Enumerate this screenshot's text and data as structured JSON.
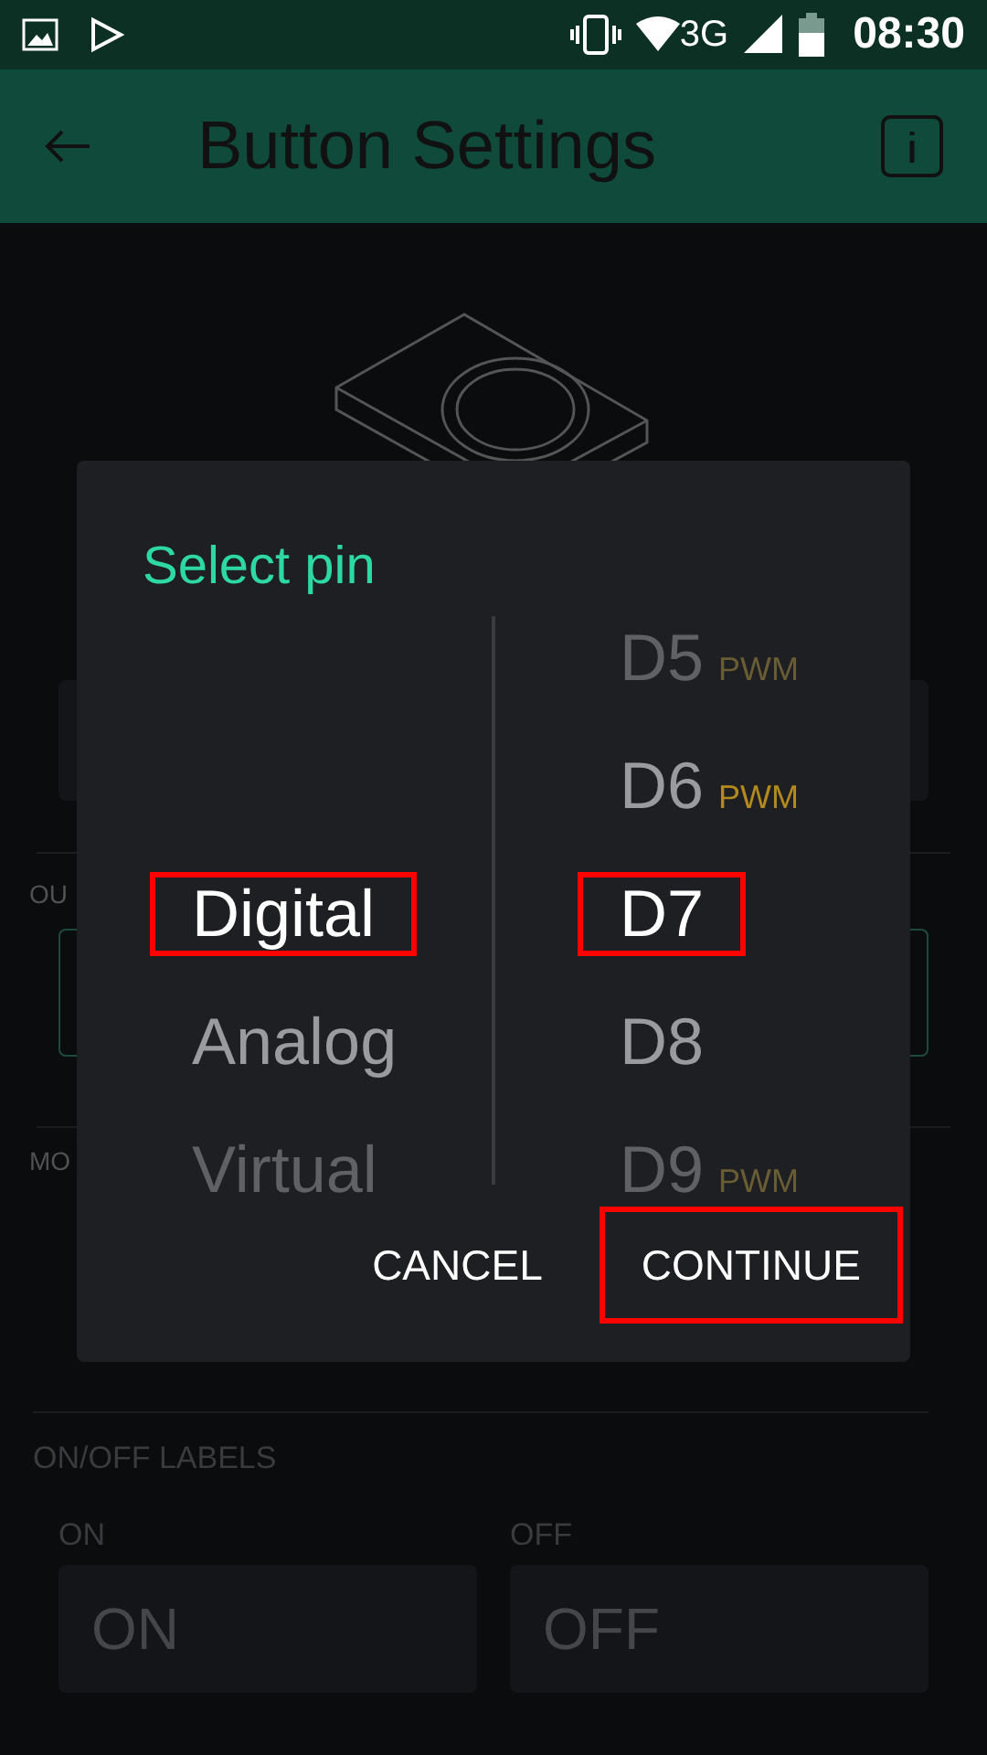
{
  "status_bar": {
    "time": "08:30",
    "network": "3G"
  },
  "app_bar": {
    "title": "Button Settings"
  },
  "background": {
    "section_labels": [
      "OU",
      "MO"
    ],
    "labels_section": {
      "title": "ON/OFF LABELS",
      "fields": [
        {
          "label": "ON",
          "placeholder": "ON"
        },
        {
          "label": "OFF",
          "placeholder": "OFF"
        }
      ]
    }
  },
  "dialog": {
    "title": "Select pin",
    "pin_types": [
      {
        "label": "Digital",
        "selected": true,
        "highlighted": true
      },
      {
        "label": "Analog",
        "selected": false,
        "highlighted": false
      },
      {
        "label": "Virtual",
        "selected": false,
        "highlighted": false
      }
    ],
    "pins": [
      {
        "label": "D5",
        "tag": "PWM",
        "selected": false,
        "highlighted": false
      },
      {
        "label": "D6",
        "tag": "PWM",
        "selected": false,
        "highlighted": false
      },
      {
        "label": "D7",
        "selected": true,
        "highlighted": true
      },
      {
        "label": "D8",
        "selected": false,
        "highlighted": false
      },
      {
        "label": "D9",
        "tag": "PWM",
        "selected": false,
        "highlighted": false
      }
    ],
    "buttons": [
      {
        "label": "CANCEL",
        "highlighted": false
      },
      {
        "label": "CONTINUE",
        "highlighted": true
      }
    ]
  }
}
